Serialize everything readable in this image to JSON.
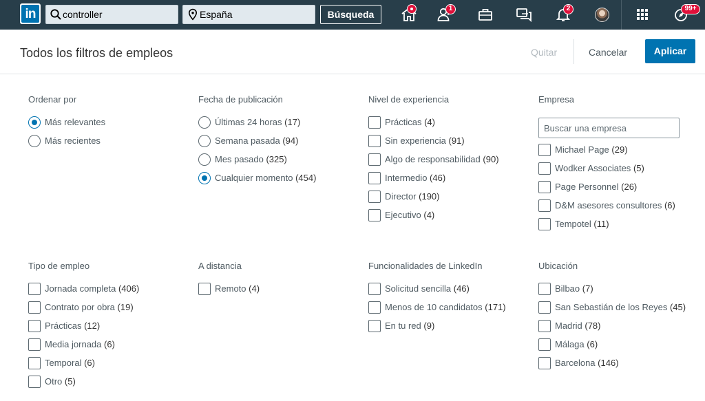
{
  "nav": {
    "logo": "in",
    "search_value": "controller",
    "location_value": "España",
    "search_button": "Búsqueda",
    "badges": {
      "messaging_jobs": "1",
      "notifications": "2",
      "work": "99+"
    }
  },
  "header": {
    "title": "Todos los filtros de empleos",
    "clear": "Quitar",
    "cancel": "Cancelar",
    "apply": "Aplicar"
  },
  "groups": {
    "sort": {
      "title": "Ordenar por",
      "options": [
        {
          "label": "Más relevantes",
          "selected": true
        },
        {
          "label": "Más recientes",
          "selected": false
        }
      ]
    },
    "date": {
      "title": "Fecha de publicación",
      "options": [
        {
          "label": "Últimas 24 horas",
          "count": "(17)",
          "selected": false
        },
        {
          "label": "Semana pasada",
          "count": "(94)",
          "selected": false
        },
        {
          "label": "Mes pasado",
          "count": "(325)",
          "selected": false
        },
        {
          "label": "Cualquier momento",
          "count": "(454)",
          "selected": true
        }
      ]
    },
    "experience": {
      "title": "Nivel de experiencia",
      "options": [
        {
          "label": "Prácticas",
          "count": "(4)"
        },
        {
          "label": "Sin experiencia",
          "count": "(91)"
        },
        {
          "label": "Algo de responsabilidad",
          "count": "(90)"
        },
        {
          "label": "Intermedio",
          "count": "(46)"
        },
        {
          "label": "Director",
          "count": "(190)"
        },
        {
          "label": "Ejecutivo",
          "count": "(4)"
        }
      ]
    },
    "company": {
      "title": "Empresa",
      "placeholder": "Buscar una empresa",
      "options": [
        {
          "label": "Michael Page",
          "count": "(29)"
        },
        {
          "label": "Wodker Associates",
          "count": "(5)"
        },
        {
          "label": "Page Personnel",
          "count": "(26)"
        },
        {
          "label": "D&M asesores consultores",
          "count": "(6)"
        },
        {
          "label": "Tempotel",
          "count": "(11)"
        }
      ]
    },
    "job_type": {
      "title": "Tipo de empleo",
      "options": [
        {
          "label": "Jornada completa",
          "count": "(406)"
        },
        {
          "label": "Contrato por obra",
          "count": "(19)"
        },
        {
          "label": "Prácticas",
          "count": "(12)"
        },
        {
          "label": "Media jornada",
          "count": "(6)"
        },
        {
          "label": "Temporal",
          "count": "(6)"
        },
        {
          "label": "Otro",
          "count": "(5)"
        }
      ]
    },
    "remote": {
      "title": "A distancia",
      "options": [
        {
          "label": "Remoto",
          "count": "(4)"
        }
      ]
    },
    "features": {
      "title": "Funcionalidades de LinkedIn",
      "options": [
        {
          "label": "Solicitud sencilla",
          "count": "(46)"
        },
        {
          "label": "Menos de 10 candidatos",
          "count": "(171)"
        },
        {
          "label": "En tu red",
          "count": "(9)"
        }
      ]
    },
    "location": {
      "title": "Ubicación",
      "options": [
        {
          "label": "Bilbao",
          "count": "(7)"
        },
        {
          "label": "San Sebastián de los Reyes",
          "count": "(45)"
        },
        {
          "label": "Madrid",
          "count": "(78)"
        },
        {
          "label": "Málaga",
          "count": "(6)"
        },
        {
          "label": "Barcelona",
          "count": "(146)"
        }
      ]
    }
  }
}
